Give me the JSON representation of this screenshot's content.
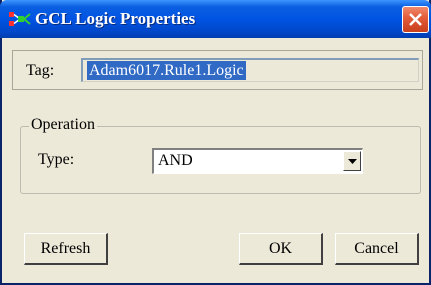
{
  "window": {
    "title": "GCL Logic Properties",
    "icon": "gcl-logic-icon",
    "close_icon": "close-icon"
  },
  "tag": {
    "label": "Tag:",
    "value": "Adam6017.Rule1.Logic"
  },
  "operation": {
    "legend": "Operation",
    "type_label": "Type:",
    "type_value": "AND",
    "dropdown_icon": "chevron-down-icon"
  },
  "buttons": {
    "refresh": "Refresh",
    "ok": "OK",
    "cancel": "Cancel"
  },
  "colors": {
    "titlebar": "#0054e3",
    "dialog_background": "#ece9d8",
    "selection": "#316ac5",
    "close_button": "#e25a37"
  }
}
